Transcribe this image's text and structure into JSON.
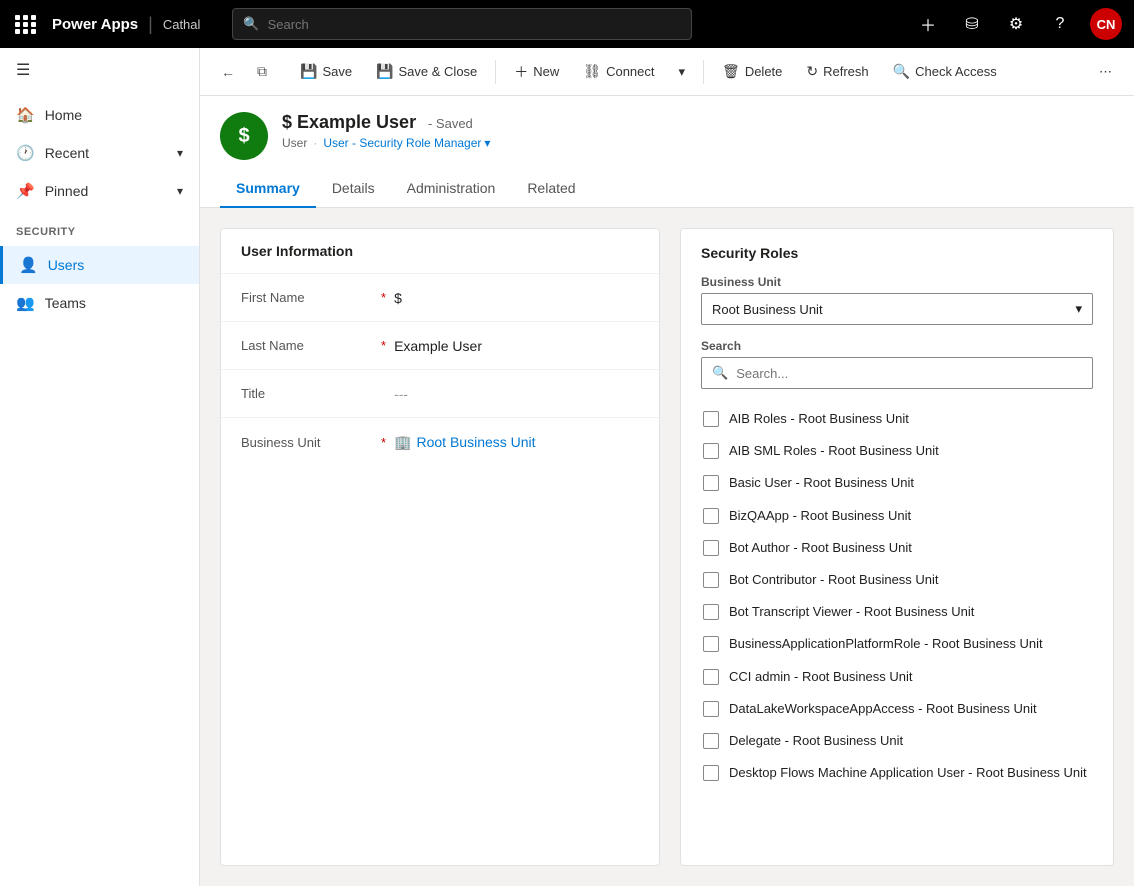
{
  "topbar": {
    "brand": "Power Apps",
    "env": "Cathal",
    "search_placeholder": "Search",
    "avatar_initials": "CN"
  },
  "sidebar": {
    "toggle_label": "Collapse sidebar",
    "nav_items": [
      {
        "id": "home",
        "label": "Home",
        "icon": "🏠"
      },
      {
        "id": "recent",
        "label": "Recent",
        "icon": "🕐",
        "expandable": true
      },
      {
        "id": "pinned",
        "label": "Pinned",
        "icon": "📌",
        "expandable": true
      }
    ],
    "group_label": "Security",
    "group_items": [
      {
        "id": "users",
        "label": "Users",
        "icon": "👤",
        "active": true
      },
      {
        "id": "teams",
        "label": "Teams",
        "icon": "👥"
      }
    ]
  },
  "toolbar": {
    "save_label": "Save",
    "save_close_label": "Save & Close",
    "new_label": "New",
    "connect_label": "Connect",
    "delete_label": "Delete",
    "refresh_label": "Refresh",
    "check_access_label": "Check Access"
  },
  "record": {
    "avatar_letter": "$",
    "title": "$ Example User",
    "status": "Saved",
    "breadcrumb_1": "User",
    "breadcrumb_2": "User - Security Role Manager",
    "tabs": [
      "Summary",
      "Details",
      "Administration",
      "Related"
    ],
    "active_tab": "Summary"
  },
  "form": {
    "title": "User Information",
    "fields": [
      {
        "label": "First Name",
        "required": true,
        "value": "$",
        "type": "text"
      },
      {
        "label": "Last Name",
        "required": true,
        "value": "Example User",
        "type": "text"
      },
      {
        "label": "Title",
        "required": false,
        "value": "---",
        "type": "empty"
      },
      {
        "label": "Business Unit",
        "required": true,
        "value": "Root Business Unit",
        "type": "link"
      }
    ]
  },
  "security": {
    "panel_title": "Security Roles",
    "business_unit_label": "Business Unit",
    "business_unit_value": "Root Business Unit",
    "search_label": "Search",
    "search_placeholder": "Search...",
    "roles": [
      {
        "label": "AIB Roles - Root Business Unit"
      },
      {
        "label": "AIB SML Roles - Root Business Unit"
      },
      {
        "label": "Basic User - Root Business Unit"
      },
      {
        "label": "BizQAApp - Root Business Unit"
      },
      {
        "label": "Bot Author - Root Business Unit"
      },
      {
        "label": "Bot Contributor - Root Business Unit"
      },
      {
        "label": "Bot Transcript Viewer - Root Business Unit"
      },
      {
        "label": "BusinessApplicationPlatformRole - Root Business Unit"
      },
      {
        "label": "CCI admin - Root Business Unit"
      },
      {
        "label": "DataLakeWorkspaceAppAccess - Root Business Unit"
      },
      {
        "label": "Delegate - Root Business Unit"
      },
      {
        "label": "Desktop Flows Machine Application User - Root Business Unit"
      }
    ]
  }
}
